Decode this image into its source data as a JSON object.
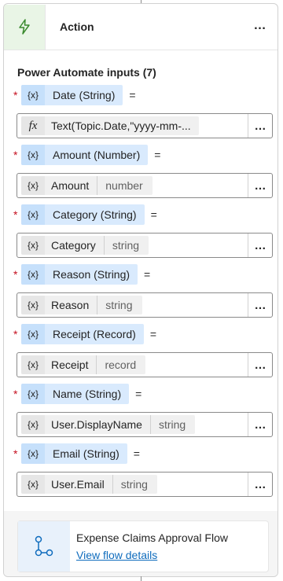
{
  "header": {
    "title": "Action",
    "more_label": "…",
    "icon": "lightning-icon"
  },
  "section": {
    "title": "Power Automate inputs (7)"
  },
  "params": [
    {
      "required": "*",
      "name": "Date (String)",
      "equals": "=",
      "value_icon": "fx",
      "value": "Text(Topic.Date,\"yyyy-mm-...",
      "type": ""
    },
    {
      "required": "*",
      "name": "Amount (Number)",
      "equals": "=",
      "value_icon": "{x}",
      "value": "Amount",
      "type": "number"
    },
    {
      "required": "*",
      "name": "Category (String)",
      "equals": "=",
      "value_icon": "{x}",
      "value": "Category",
      "type": "string"
    },
    {
      "required": "*",
      "name": "Reason (String)",
      "equals": "=",
      "value_icon": "{x}",
      "value": "Reason",
      "type": "string"
    },
    {
      "required": "*",
      "name": "Receipt (Record)",
      "equals": "=",
      "value_icon": "{x}",
      "value": "Receipt",
      "type": "record"
    },
    {
      "required": "*",
      "name": "Name (String)",
      "equals": "=",
      "value_icon": "{x}",
      "value": "User.DisplayName",
      "type": "string"
    },
    {
      "required": "*",
      "name": "Email (String)",
      "equals": "=",
      "value_icon": "{x}",
      "value": "User.Email",
      "type": "string"
    }
  ],
  "var_icon": "{x}",
  "more_label": "…",
  "flow": {
    "name": "Expense Claims Approval Flow",
    "link": "View flow details",
    "icon": "flow-icon"
  },
  "colors": {
    "accent": "#0f6cbd",
    "chip": "#d9eafd",
    "header_bg": "#e9f5e6",
    "required": "#c50f1f"
  }
}
